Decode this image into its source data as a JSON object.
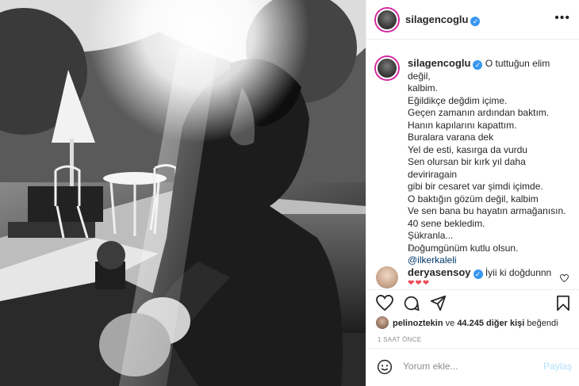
{
  "post": {
    "username": "silagencoglu",
    "verified": true,
    "more_label": "•••",
    "caption_lines": [
      "O tuttuğun elim değil,",
      "kalbim.",
      "Eğildikçe değdim içime.",
      "Geçen zamanın ardından baktım.",
      "Hanın kapılarını kapattım.",
      "Buralara varana dek",
      "Yel de esti, kasırga da vurdu",
      "Sen olursan bir kırk yıl daha deviriragain",
      "gibi bir cesaret var şimdi içimde.",
      "O baktığın gözüm değil, kalbim",
      "Ve sen bana bu hayatın armağanısın.",
      "40 sene bekledim.",
      "Şükranla...",
      "Doğumgünüm kutlu olsun."
    ],
    "mention": "@ilkerkaleli",
    "time_ago": "1s"
  },
  "comment": {
    "username": "deryasensoy",
    "text": "İyii ki doğdunnn",
    "hearts": "❤❤❤"
  },
  "likes": {
    "user": "pelinoztekin",
    "connector": "ve",
    "count_text": "44.245 diğer kişi",
    "suffix": "beğendi"
  },
  "date_label": "1 SAAT ÖNCE",
  "add_comment": {
    "placeholder": "Yorum ekle...",
    "share_label": "Paylaş"
  },
  "icons": {
    "like": "heart-icon",
    "comment": "comment-icon",
    "share": "send-icon",
    "save": "bookmark-icon",
    "emoji": "smiley-icon"
  }
}
